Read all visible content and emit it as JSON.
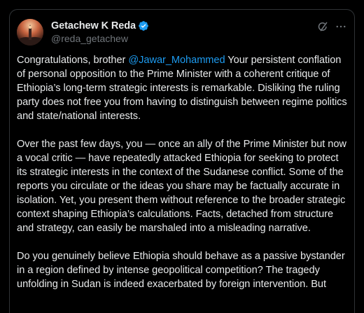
{
  "post": {
    "author": {
      "display_name": "Getachew K Reda",
      "handle": "@reda_getachew",
      "verified": true,
      "verified_color": "#1d9bf0"
    },
    "actions": {
      "grok_icon": "grok-icon",
      "more_icon": "more-icon"
    },
    "paragraphs": [
      {
        "pre": "Congratulations, brother ",
        "mention": "@Jawar_Mohammed",
        "post": " Your persistent conflation of personal opposition to the Prime Minister with a coherent critique of Ethiopia’s long-term strategic interests is remarkable. Disliking the ruling party does not free you from having to distinguish between regime politics and state/national interests."
      },
      {
        "text": "Over the past few days, you — once an ally of the Prime Minister but now a vocal critic — have repeatedly attacked Ethiopia for seeking to protect its strategic interests in the context of the Sudanese conflict. Some of the reports you circulate or the ideas you share may be factually accurate in isolation. Yet, you present them without reference to the broader strategic context shaping Ethiopia’s calculations. Facts, detached from structure and strategy, can easily be marshaled into a misleading narrative."
      },
      {
        "text": "Do you genuinely believe Ethiopia should behave as a passive bystander in a region defined by intense geopolitical competition? The tragedy unfolding in Sudan is indeed exacerbated by foreign intervention. But"
      }
    ]
  },
  "colors": {
    "background": "#000000",
    "text": "#e7e9ea",
    "secondary_text": "#71767b",
    "link": "#1d9bf0",
    "border": "#2f3336"
  }
}
